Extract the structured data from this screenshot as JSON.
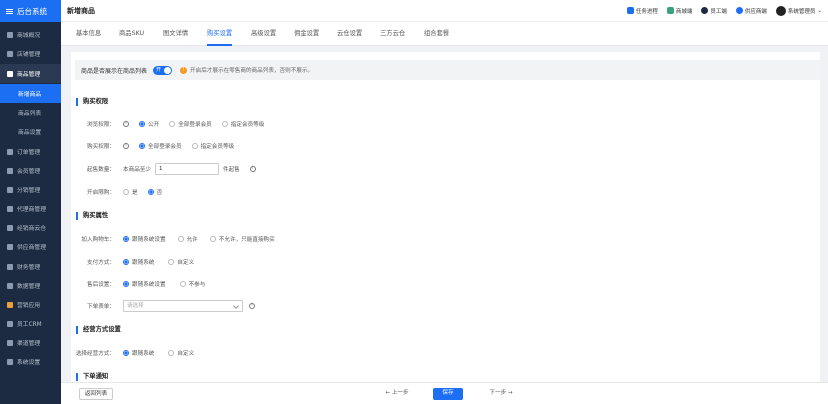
{
  "sidebar": {
    "title": "后台系统",
    "items": [
      {
        "label": "商城概况"
      },
      {
        "label": "店铺管理"
      },
      {
        "label": "商品管理"
      },
      {
        "label": "新增商品"
      },
      {
        "label": "商品列表"
      },
      {
        "label": "商品设置"
      },
      {
        "label": "订单管理"
      },
      {
        "label": "会员管理"
      },
      {
        "label": "分销管理"
      },
      {
        "label": "代理商管理"
      },
      {
        "label": "经销商云仓"
      },
      {
        "label": "供应商管理"
      },
      {
        "label": "财务管理"
      },
      {
        "label": "数据管理"
      },
      {
        "label": "营销应用"
      },
      {
        "label": "员工CRM"
      },
      {
        "label": "渠道管理"
      },
      {
        "label": "系统设置"
      }
    ]
  },
  "header": {
    "title": "新增商品",
    "tools": [
      {
        "label": "任务进程",
        "color": "#1c6ef3"
      },
      {
        "label": "商城端",
        "color": "#3aa17e"
      },
      {
        "label": "员工端",
        "color": "#1c2b41"
      },
      {
        "label": "供应商端",
        "color": "#1c6ef3"
      }
    ],
    "user": "系统管理员"
  },
  "tabs": [
    {
      "label": "基本信息"
    },
    {
      "label": "商品SKU"
    },
    {
      "label": "图文详情"
    },
    {
      "label": "购买设置"
    },
    {
      "label": "高级设置"
    },
    {
      "label": "佣金设置"
    },
    {
      "label": "云仓设置"
    },
    {
      "label": "三方云仓"
    },
    {
      "label": "组合套餐"
    }
  ],
  "notice": {
    "label": "商品是否展示在商品列表",
    "switch_text": "开",
    "hint": "开启后才展示在零售商的商品列表，否则不展示。"
  },
  "sections": {
    "purchase_permission": "购买权限",
    "purchase_attributes": "购买属性",
    "delivery": "经营方式设置",
    "order_notice": "下单通知"
  },
  "form": {
    "browse": {
      "label": "浏览权限：",
      "options": [
        "公开",
        "全部登录会员",
        "指定会员等级"
      ]
    },
    "buy": {
      "label": "购买权限：",
      "options": [
        "全部登录会员",
        "指定会员等级"
      ]
    },
    "min_qty": {
      "label": "起售数量：",
      "prefix": "本商品至少",
      "value": "1",
      "suffix": "件起售"
    },
    "limit": {
      "label": "开启限购：",
      "options": [
        "是",
        "否"
      ]
    },
    "cart": {
      "label": "加入购物车：",
      "options": [
        "跟随系统设置",
        "允许",
        "不允许，只能直接购买"
      ]
    },
    "pay": {
      "label": "支付方式：",
      "options": [
        "跟随系统",
        "自定义"
      ]
    },
    "after_sale": {
      "label": "售后设置：",
      "options": [
        "跟随系统设置",
        "不参与"
      ]
    },
    "order_form": {
      "label": "下单表单：",
      "placeholder": "请选择"
    },
    "delivery_method": {
      "label": "选择经营方式：",
      "options": [
        "跟随系统",
        "自定义"
      ]
    }
  },
  "footer": {
    "back": "返回列表",
    "prev": "← 上一步",
    "save": "保存",
    "next": "下一步 →"
  }
}
